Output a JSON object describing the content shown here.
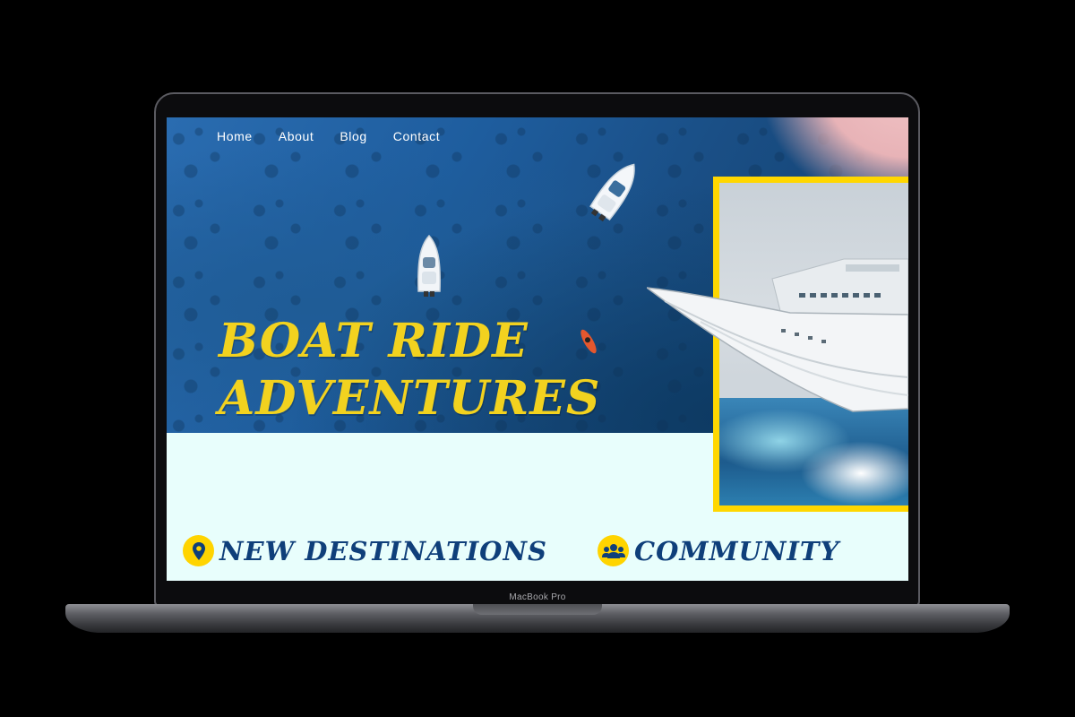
{
  "device": {
    "label": "MacBook Pro"
  },
  "nav": {
    "items": [
      {
        "label": "Home"
      },
      {
        "label": "About"
      },
      {
        "label": "Blog"
      },
      {
        "label": "Contact"
      }
    ]
  },
  "hero": {
    "title_line1": "BOAT RIDE",
    "title_line2": "ADVENTURES"
  },
  "features": [
    {
      "label": "NEW DESTINATIONS",
      "icon": "location-pin-icon"
    },
    {
      "label": "COMMUNITY",
      "icon": "people-group-icon"
    }
  ],
  "colors": {
    "accent_yellow": "#ffd700",
    "title_yellow": "#f2d21f",
    "feature_navy": "#0f3f7a",
    "content_bg": "#e8fefc",
    "sea_blue": "#1e5d9e"
  }
}
